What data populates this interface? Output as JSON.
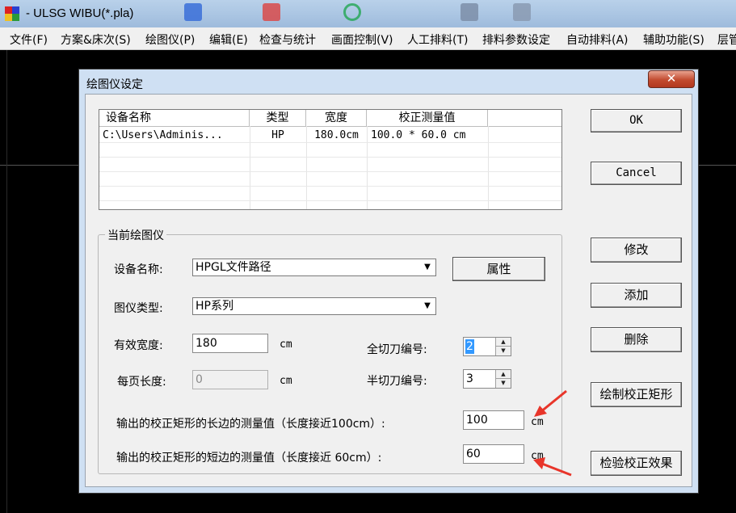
{
  "app": {
    "title": "- ULSG WIBU(*.pla)"
  },
  "menu": [
    "文件(F)",
    "方案&床次(S)",
    "绘图仪(P)",
    "编辑(E)",
    "检查与统计",
    "画面控制(V)",
    "人工排料(T)",
    "排料参数设定",
    "自动排料(A)",
    "辅助功能(S)",
    "层管"
  ],
  "dialog": {
    "title": "绘图仪设定",
    "close_glyph": "✕",
    "list": {
      "columns": [
        "设备名称",
        "类型",
        "宽度",
        "校正测量值"
      ],
      "rows": [
        [
          "C:\\Users\\Adminis...",
          "HP",
          "180.0cm",
          "100.0 * 60.0 cm"
        ]
      ]
    },
    "group_title": "当前绘图仪",
    "device_name_label": "设备名称:",
    "device_name_value": "HPGL文件路径",
    "properties_button": "属性",
    "plotter_type_label": "图仪类型:",
    "plotter_type_value": "HP系列",
    "effective_width_label": "有效宽度:",
    "effective_width_value": "180",
    "page_length_label": "每页长度:",
    "page_length_value": "0",
    "unit_cm": "cm",
    "full_cut_label": "全切刀编号:",
    "full_cut_value": "2",
    "half_cut_label": "半切刀编号:",
    "half_cut_value": "3",
    "long_side_label": "输出的校正矩形的长边的测量值（长度接近100cm）:",
    "long_side_value": "100",
    "short_side_label": "输出的校正矩形的短边的测量值（长度接近 60cm）:",
    "short_side_value": "60",
    "buttons": {
      "ok": "OK",
      "cancel": "Cancel",
      "modify": "修改",
      "add": "添加",
      "delete": "删除",
      "draw_rect": "绘制校正矩形",
      "verify": "检验校正效果"
    }
  },
  "colors": {
    "annotation_arrow": "#e8352a",
    "selection": "#3399ff"
  }
}
